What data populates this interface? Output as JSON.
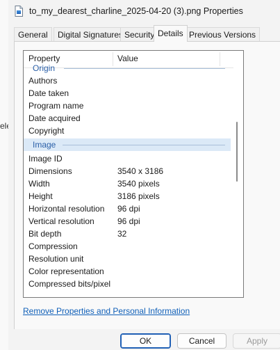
{
  "background_window": {
    "fragment": "ele"
  },
  "window": {
    "title": "to_my_dearest_charline_2025-04-20 (3).png Properties",
    "icon": "png-file-icon"
  },
  "tabs": [
    {
      "label": "General",
      "active": false
    },
    {
      "label": "Digital Signatures",
      "active": false
    },
    {
      "label": "Security",
      "active": false
    },
    {
      "label": "Details",
      "active": true
    },
    {
      "label": "Previous Versions",
      "active": false
    }
  ],
  "list": {
    "columns": {
      "property": "Property",
      "value": "Value"
    },
    "groups": {
      "origin": "Origin",
      "image": "Image"
    },
    "origin_rows": [
      {
        "property": "Authors",
        "value": ""
      },
      {
        "property": "Date taken",
        "value": ""
      },
      {
        "property": "Program name",
        "value": ""
      },
      {
        "property": "Date acquired",
        "value": ""
      },
      {
        "property": "Copyright",
        "value": ""
      }
    ],
    "image_rows": [
      {
        "property": "Image ID",
        "value": ""
      },
      {
        "property": "Dimensions",
        "value": "3540 x 3186"
      },
      {
        "property": "Width",
        "value": "3540 pixels"
      },
      {
        "property": "Height",
        "value": "3186 pixels"
      },
      {
        "property": "Horizontal resolution",
        "value": "96 dpi"
      },
      {
        "property": "Vertical resolution",
        "value": "96 dpi"
      },
      {
        "property": "Bit depth",
        "value": "32"
      },
      {
        "property": "Compression",
        "value": ""
      },
      {
        "property": "Resolution unit",
        "value": ""
      },
      {
        "property": "Color representation",
        "value": ""
      },
      {
        "property": "Compressed bits/pixel",
        "value": ""
      }
    ]
  },
  "remove_link": "Remove Properties and Personal Information",
  "buttons": {
    "ok": "OK",
    "cancel": "Cancel",
    "apply": "Apply"
  },
  "colors": {
    "accent": "#1f5fb5",
    "group_text": "#2a5fa8",
    "selection": "#dbe9f7",
    "link": "#0f5fb8"
  }
}
